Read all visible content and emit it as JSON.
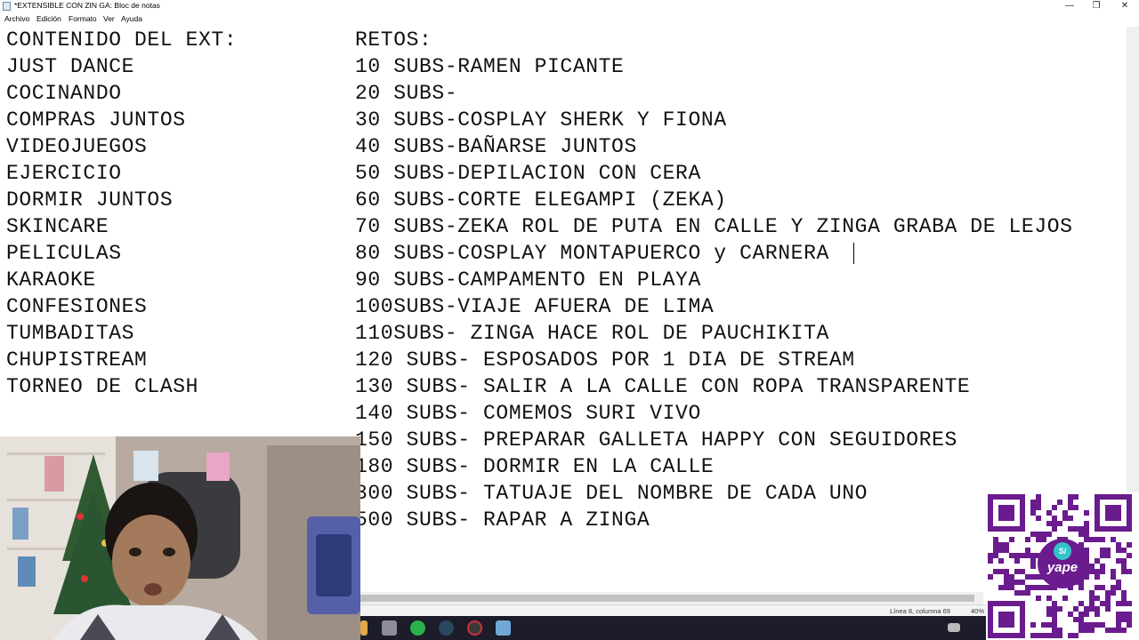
{
  "window": {
    "title": "*EXTENSIBLE CON ZIN GA: Bloc de notas",
    "controls": [
      "—",
      "❐",
      "✕"
    ]
  },
  "menu": [
    "Archivo",
    "Edición",
    "Formato",
    "Ver",
    "Ayuda"
  ],
  "editor": {
    "left_column": [
      "CONTENIDO DEL EXT:",
      "JUST DANCE",
      "COCINANDO",
      "COMPRAS JUNTOS",
      "VIDEOJUEGOS",
      "EJERCICIO",
      "DORMIR JUNTOS",
      "SKINCARE",
      "PELICULAS",
      "KARAOKE",
      "CONFESIONES",
      "TUMBADITAS",
      "CHUPISTREAM",
      "TORNEO DE CLASH"
    ],
    "right_column": [
      "RETOS:",
      "10 SUBS-RAMEN PICANTE",
      "20 SUBS-",
      "30 SUBS-COSPLAY SHERK Y FIONA",
      "40 SUBS-BAÑARSE JUNTOS",
      "50 SUBS-DEPILACION CON CERA",
      "60 SUBS-CORTE ELEGAMPI (ZEKA)",
      "70 SUBS-ZEKA ROL DE PUTA EN CALLE Y ZINGA GRABA DE LEJOS",
      "80 SUBS-COSPLAY MONTAPUERCO y CARNERA",
      "90 SUBS-CAMPAMENTO EN PLAYA",
      "100SUBS-VIAJE AFUERA DE LIMA",
      "110SUBS- ZINGA HACE ROL DE PAUCHIKITA",
      "120 SUBS- ESPOSADOS POR 1 DIA DE STREAM",
      "130 SUBS- SALIR A LA CALLE CON ROPA TRANSPARENTE",
      "140 SUBS- COMEMOS SURI VIVO",
      "150 SUBS- PREPARAR GALLETA HAPPY CON SEGUIDORES",
      "180 SUBS- DORMIR EN LA CALLE",
      "300 SUBS- TATUAJE DEL NOMBRE DE CADA UNO",
      "500 SUBS- RAPAR A ZINGA"
    ]
  },
  "status": {
    "position": "Línea 8, columna 69",
    "zoom": "40%"
  },
  "overlay": {
    "qr_brand": "yape",
    "qr_badge": "S/"
  },
  "colors": {
    "taskbar": "#1c1c2a",
    "yape_purple": "#6a1b8e",
    "yape_teal": "#33c3c8"
  }
}
